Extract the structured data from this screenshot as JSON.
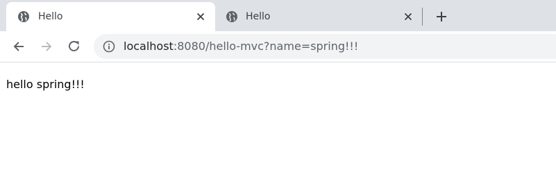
{
  "tabs": [
    {
      "title": "Hello",
      "active": true,
      "icon": "globe-icon"
    },
    {
      "title": "Hello",
      "active": false,
      "icon": "globe-icon"
    }
  ],
  "toolbar": {
    "address": {
      "host": "localhost",
      "path": ":8080/hello-mvc?name=spring!!!"
    }
  },
  "page": {
    "body_text": "hello spring!!!"
  },
  "colors": {
    "tabstrip_bg": "#dee1e6",
    "omnibox_bg": "#f1f3f4",
    "icon": "#5f6368"
  }
}
